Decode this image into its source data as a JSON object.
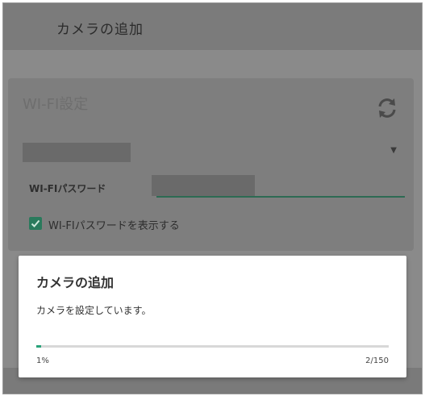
{
  "appbar": {
    "title": "カメラの追加"
  },
  "wifi_card": {
    "title": "WI-FI設定",
    "password_label": "WI-FIパスワード",
    "show_password_label": "WI-FIパスワードを表示する",
    "show_password_checked": true
  },
  "dialog": {
    "title": "カメラの追加",
    "message": "カメラを設定しています。",
    "progress_percent": "1%",
    "progress_count": "2/150",
    "progress_fraction": 0.013
  },
  "colors": {
    "accent": "#2aa37a",
    "checkbox": "#2a7a5c",
    "overlay": "#8a8a8a"
  },
  "icons": [
    "refresh-icon",
    "chevron-down-icon",
    "check-icon"
  ]
}
